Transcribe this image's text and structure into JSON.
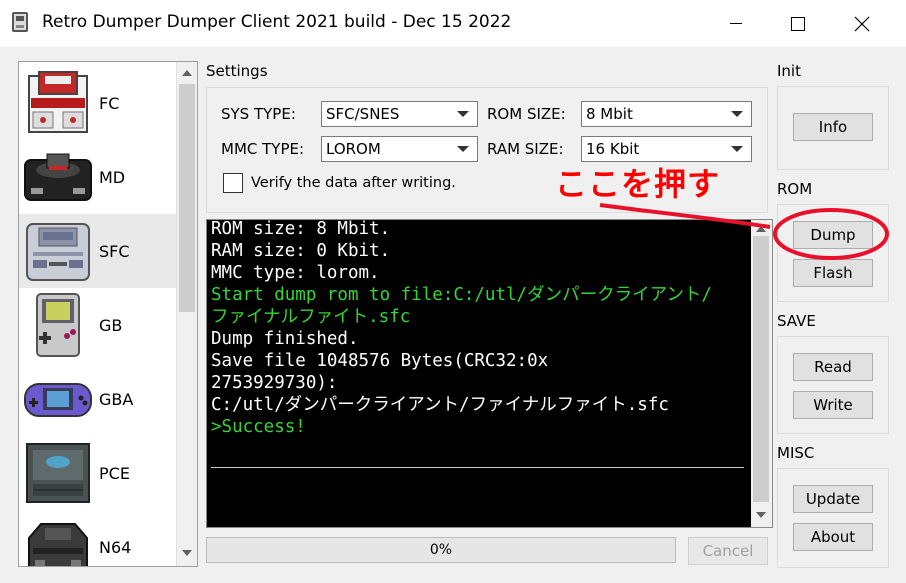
{
  "window": {
    "title": "Retro Dumper Dumper Client 2021 build - Dec 15 2022"
  },
  "console_list": {
    "items": [
      {
        "label": "FC",
        "icon": "famicom-icon",
        "selected": false
      },
      {
        "label": "MD",
        "icon": "mega-drive-icon",
        "selected": false
      },
      {
        "label": "SFC",
        "icon": "super-famicom-icon",
        "selected": true
      },
      {
        "label": "GB",
        "icon": "game-boy-icon",
        "selected": false
      },
      {
        "label": "GBA",
        "icon": "game-boy-advance-icon",
        "selected": false
      },
      {
        "label": "PCE",
        "icon": "pc-engine-icon",
        "selected": false
      },
      {
        "label": "N64",
        "icon": "nintendo-64-icon",
        "selected": false
      }
    ]
  },
  "settings": {
    "title": "Settings",
    "sys_type_label": "SYS TYPE:",
    "sys_type_value": "SFC/SNES",
    "rom_size_label": "ROM SIZE:",
    "rom_size_value": "8 Mbit",
    "mmc_type_label": "MMC TYPE:",
    "mmc_type_value": "LOROM",
    "ram_size_label": "RAM SIZE:",
    "ram_size_value": "16 Kbit",
    "verify_label": "Verify the data after writing.",
    "verify_checked": false
  },
  "log": {
    "lines": [
      {
        "text": "ROM size: 8 Mbit.",
        "color": "#ffffff"
      },
      {
        "text": "RAM size: 0 Kbit.",
        "color": "#ffffff"
      },
      {
        "text": "MMC type: lorom.",
        "color": "#ffffff"
      },
      {
        "text": "Start dump rom to file:C:/utl/ダンパークライアント/",
        "color": "#33d633"
      },
      {
        "text": "ファイナルファイト.sfc",
        "color": "#33d633"
      },
      {
        "text": "Dump finished.",
        "color": "#ffffff"
      },
      {
        "text": "Save file 1048576 Bytes(CRC32:0x",
        "color": "#ffffff"
      },
      {
        "text": "2753929730):",
        "color": "#ffffff"
      },
      {
        "text": "C:/utl/ダンパークライアント/ファイナルファイト.sfc",
        "color": "#ffffff"
      },
      {
        "text": ">Success!",
        "color": "#33d633"
      }
    ]
  },
  "progress": {
    "value": 0,
    "text": "0%"
  },
  "cancel_label": "Cancel",
  "side_panel": {
    "init_title": "Init",
    "info_label": "Info",
    "rom_title": "ROM",
    "dump_label": "Dump",
    "flash_label": "Flash",
    "save_title": "SAVE",
    "read_label": "Read",
    "write_label": "Write",
    "misc_title": "MISC",
    "update_label": "Update",
    "about_label": "About"
  },
  "annotation": {
    "text": "ここを押す",
    "color": "#ff0000"
  }
}
